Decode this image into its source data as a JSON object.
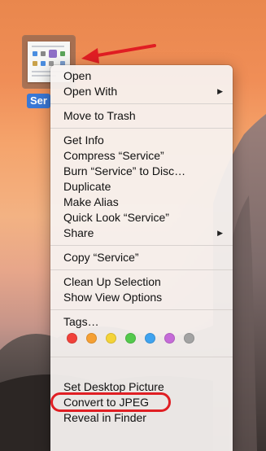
{
  "desktop": {
    "file": {
      "label": "Ser",
      "icon": "document-thumbnail-icon"
    },
    "annotation_color": "#e01e23"
  },
  "context_menu": {
    "groups": [
      [
        {
          "label": "Open"
        },
        {
          "label": "Open With",
          "submenu": "▶"
        }
      ],
      [
        {
          "label": "Move to Trash"
        }
      ],
      [
        {
          "label": "Get Info"
        },
        {
          "label": "Compress “Service”"
        },
        {
          "label": "Burn “Service” to Disc…"
        },
        {
          "label": "Duplicate"
        },
        {
          "label": "Make Alias"
        },
        {
          "label": "Quick Look “Service”"
        },
        {
          "label": "Share",
          "submenu": "▶"
        }
      ],
      [
        {
          "label": "Copy “Service”"
        }
      ],
      [
        {
          "label": "Clean Up Selection"
        },
        {
          "label": "Show View Options"
        }
      ],
      [
        {
          "label": "Tags…"
        }
      ]
    ],
    "tag_colors": [
      {
        "name": "red",
        "color": "#f1413a"
      },
      {
        "name": "orange",
        "color": "#f5a033"
      },
      {
        "name": "yellow",
        "color": "#f4d338"
      },
      {
        "name": "green",
        "color": "#53c94c"
      },
      {
        "name": "blue",
        "color": "#3fa3ef"
      },
      {
        "name": "purple",
        "color": "#c56bd8"
      },
      {
        "name": "gray",
        "color": "#a3a3a3"
      }
    ],
    "bottom_items": [
      {
        "label": "Set Desktop Picture"
      },
      {
        "label": "Convert to JPEG"
      },
      {
        "label": "Reveal in Finder"
      }
    ]
  }
}
